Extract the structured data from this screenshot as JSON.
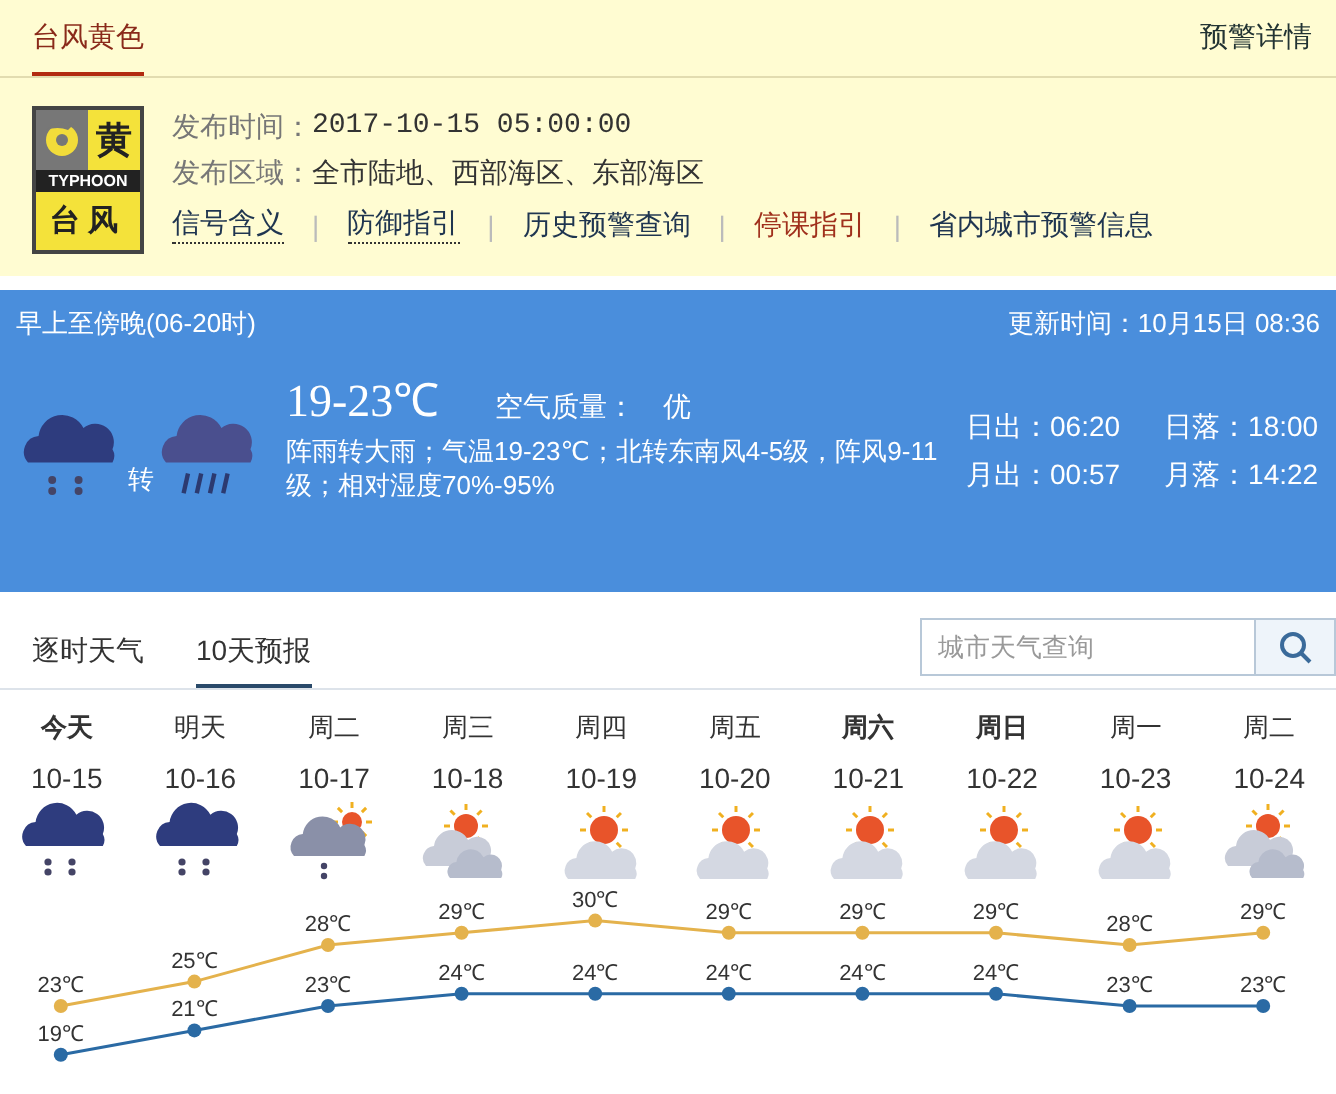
{
  "alert_tabs": [
    {
      "label": "台风黄色",
      "selected": true
    }
  ],
  "alert_detail_link": "预警详情",
  "alert": {
    "badge": {
      "level_char": "黄",
      "label_en": "TYPHOON",
      "label": "台风"
    },
    "fields": [
      {
        "label": "发布时间：",
        "value": "2017-10-15 05:00:00"
      },
      {
        "label": "发布区域：",
        "value": "全市陆地、西部海区、东部海区"
      }
    ],
    "separator": "|",
    "links": [
      {
        "label": "信号含义",
        "kind": "dotted"
      },
      {
        "label": "防御指引",
        "kind": "dotted"
      },
      {
        "label": "历史预警查询",
        "kind": "plain"
      },
      {
        "label": "停课指引",
        "kind": "alert"
      },
      {
        "label": "省内城市预警信息",
        "kind": "plain"
      }
    ]
  },
  "today": {
    "period": "早上至傍晚(06-20时)",
    "updated": "更新时间：10月15日 08:36",
    "icons": [
      {
        "kind": "rain"
      },
      {
        "kind": "heavy-rain"
      }
    ],
    "connector": "转",
    "temperature": "19-23℃",
    "air_label": "空气质量：",
    "air_value": "优",
    "description": "阵雨转大雨；气温19-23℃；北转东南风4-5级，阵风9-11级；相对湿度70%-95%",
    "sun_moon": [
      {
        "label": "日出：",
        "value": "06:20"
      },
      {
        "label": "日落：",
        "value": "18:00"
      },
      {
        "label": "月出：",
        "value": "00:57"
      },
      {
        "label": "月落：",
        "value": "14:22"
      }
    ]
  },
  "forecast_tabs": [
    {
      "label": "逐时天气",
      "selected": false
    },
    {
      "label": "10天预报",
      "selected": true
    }
  ],
  "search": {
    "placeholder": "城市天气查询"
  },
  "days": [
    {
      "day": "今天",
      "date": "10-15",
      "kind": "rain",
      "bold": true
    },
    {
      "day": "明天",
      "date": "10-16",
      "kind": "rain",
      "bold": false
    },
    {
      "day": "周二",
      "date": "10-17",
      "kind": "shower",
      "bold": false
    },
    {
      "day": "周三",
      "date": "10-18",
      "kind": "cloudy",
      "bold": false
    },
    {
      "day": "周四",
      "date": "10-19",
      "kind": "partly",
      "bold": false
    },
    {
      "day": "周五",
      "date": "10-20",
      "kind": "partly",
      "bold": false
    },
    {
      "day": "周六",
      "date": "10-21",
      "kind": "partly",
      "bold": true
    },
    {
      "day": "周日",
      "date": "10-22",
      "kind": "partly",
      "bold": true
    },
    {
      "day": "周一",
      "date": "10-23",
      "kind": "partly",
      "bold": false
    },
    {
      "day": "周二",
      "date": "10-24",
      "kind": "cloudy",
      "bold": false
    }
  ],
  "chart_data": {
    "type": "line",
    "data_labels": true,
    "series": [
      {
        "color": "#e4b24c",
        "marker": true,
        "values": [
          23,
          25,
          28,
          29,
          30,
          29,
          29,
          29,
          28,
          29
        ],
        "value_labels": [
          "23℃",
          "25℃",
          "28℃",
          "29℃",
          "30℃",
          "29℃",
          "29℃",
          "29℃",
          "28℃",
          "29℃"
        ]
      },
      {
        "color": "#2a6aa4",
        "marker": true,
        "values": [
          19,
          21,
          23,
          24,
          24,
          24,
          24,
          24,
          23,
          23
        ],
        "value_labels": [
          "19℃",
          "21℃",
          "23℃",
          "24℃",
          "24℃",
          "24℃",
          "24℃",
          "24℃",
          "23℃",
          "23℃"
        ]
      }
    ]
  }
}
